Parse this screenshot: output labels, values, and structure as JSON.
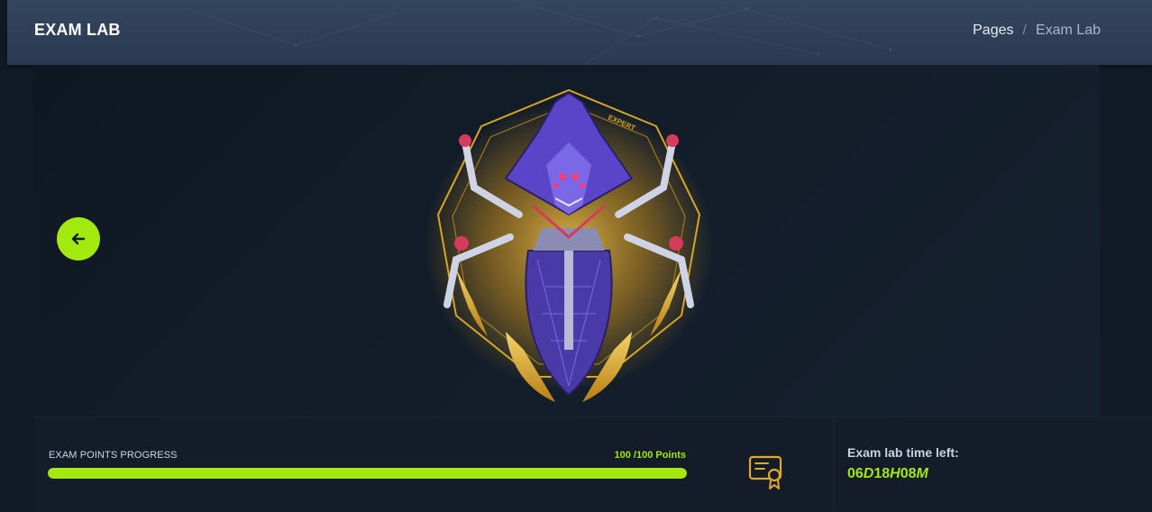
{
  "header": {
    "title": "EXAM LAB",
    "breadcrumb": {
      "root": "Pages",
      "separator": "/",
      "current": "Exam Lab"
    }
  },
  "navigation": {
    "back_icon": "arrow-left-icon"
  },
  "badge": {
    "text": "EXPERT",
    "image": "spider-mascot-emblem"
  },
  "progress": {
    "label": "EXAM POINTS PROGRESS",
    "points_text": "100 /100 Points",
    "fraction": 1.0
  },
  "certificate": {
    "icon": "certificate-icon"
  },
  "timer": {
    "label": "Exam lab time left:",
    "days": "06",
    "d_unit": "D",
    "hours": "18",
    "h_unit": "H",
    "minutes": "08",
    "m_unit": "M"
  },
  "colors": {
    "accent": "#a3e80f",
    "header_bg": "#2f3f57",
    "page_bg": "#111a25",
    "badge_purple": "#6b52d8",
    "badge_gold": "#d6a623"
  }
}
